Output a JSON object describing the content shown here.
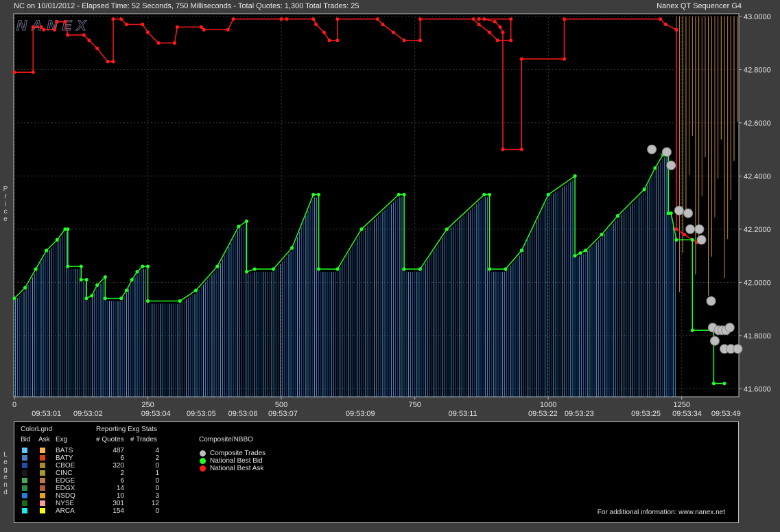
{
  "header": {
    "left": "NC on 10/01/2012  -  Elapsed Time: 52 Seconds, 750 Milliseconds  -  Total Quotes: 1,300  Total Trades: 25",
    "right": "Nanex QT Sequencer G4"
  },
  "watermark": "NANEX",
  "y_axis_title": "Price",
  "legend_side_label": "Legend",
  "chart_data": {
    "type": "line",
    "ylim": [
      41.57,
      43.01
    ],
    "xlim": [
      0,
      1300
    ],
    "y_ticks": [
      "43.0000",
      "42.8000",
      "42.6000",
      "42.4000",
      "42.2000",
      "42.0000",
      "41.8000",
      "41.6000"
    ],
    "y_tick_values": [
      43.0,
      42.8,
      42.6,
      42.4,
      42.2,
      42.0,
      41.8,
      41.6
    ],
    "x_ticks": [
      {
        "v": 0,
        "label": "0"
      },
      {
        "v": 250,
        "label": "250"
      },
      {
        "v": 500,
        "label": "500"
      },
      {
        "v": 750,
        "label": "750"
      },
      {
        "v": 1000,
        "label": "1000"
      },
      {
        "v": 1250,
        "label": "1250"
      }
    ],
    "time_labels": [
      {
        "v": 60,
        "label": "09:53:01"
      },
      {
        "v": 138,
        "label": "09:53:02"
      },
      {
        "v": 265,
        "label": "09:53:04"
      },
      {
        "v": 350,
        "label": "09:53:05"
      },
      {
        "v": 428,
        "label": "09:53:06"
      },
      {
        "v": 503,
        "label": "09:53:07"
      },
      {
        "v": 648,
        "label": "09:53:09"
      },
      {
        "v": 840,
        "label": "09:53:11"
      },
      {
        "v": 990,
        "label": "09:53:22"
      },
      {
        "v": 1058,
        "label": "09:53:23"
      },
      {
        "v": 1183,
        "label": "09:53:25"
      },
      {
        "v": 1260,
        "label": "09:53:34"
      },
      {
        "v": 1333,
        "label": "09:53:49"
      }
    ],
    "series": [
      {
        "name": "National Best Ask",
        "color": "#ff1a1a",
        "points": [
          [
            0,
            42.79
          ],
          [
            35,
            42.79
          ],
          [
            35,
            42.96
          ],
          [
            50,
            42.96
          ],
          [
            55,
            42.95
          ],
          [
            75,
            42.95
          ],
          [
            80,
            42.98
          ],
          [
            95,
            42.98
          ],
          [
            100,
            42.93
          ],
          [
            130,
            42.93
          ],
          [
            140,
            42.91
          ],
          [
            155,
            42.88
          ],
          [
            175,
            42.83
          ],
          [
            185,
            42.83
          ],
          [
            185,
            42.99
          ],
          [
            200,
            42.99
          ],
          [
            210,
            42.97
          ],
          [
            240,
            42.97
          ],
          [
            250,
            42.94
          ],
          [
            270,
            42.9
          ],
          [
            300,
            42.9
          ],
          [
            305,
            42.96
          ],
          [
            350,
            42.96
          ],
          [
            355,
            42.95
          ],
          [
            400,
            42.95
          ],
          [
            410,
            42.99
          ],
          [
            500,
            42.99
          ],
          [
            510,
            42.99
          ],
          [
            560,
            42.99
          ],
          [
            565,
            42.97
          ],
          [
            580,
            42.94
          ],
          [
            590,
            42.91
          ],
          [
            605,
            42.91
          ],
          [
            605,
            42.99
          ],
          [
            680,
            42.99
          ],
          [
            690,
            42.97
          ],
          [
            710,
            42.94
          ],
          [
            730,
            42.91
          ],
          [
            760,
            42.91
          ],
          [
            760,
            42.99
          ],
          [
            860,
            42.99
          ],
          [
            870,
            42.97
          ],
          [
            890,
            42.94
          ],
          [
            905,
            42.91
          ],
          [
            930,
            42.91
          ],
          [
            930,
            42.99
          ],
          [
            870,
            42.99
          ],
          [
            870,
            42.99
          ],
          [
            880,
            42.99
          ],
          [
            900,
            42.98
          ],
          [
            910,
            42.96
          ],
          [
            915,
            42.94
          ],
          [
            915,
            42.5
          ],
          [
            950,
            42.5
          ],
          [
            950,
            42.84
          ],
          [
            1030,
            42.84
          ],
          [
            1030,
            42.99
          ],
          [
            1210,
            42.99
          ],
          [
            1220,
            42.97
          ],
          [
            1240,
            42.95
          ],
          [
            1240,
            42.2
          ],
          [
            1255,
            42.18
          ],
          [
            1270,
            42.16
          ],
          [
            1280,
            42.15
          ],
          [
            1290,
            42.15
          ]
        ]
      },
      {
        "name": "National Best Bid",
        "color": "#22ff22",
        "points": [
          [
            0,
            41.94
          ],
          [
            20,
            41.98
          ],
          [
            40,
            42.05
          ],
          [
            60,
            42.12
          ],
          [
            80,
            42.16
          ],
          [
            95,
            42.2
          ],
          [
            100,
            42.2
          ],
          [
            100,
            42.06
          ],
          [
            125,
            42.06
          ],
          [
            125,
            42.01
          ],
          [
            135,
            42.01
          ],
          [
            135,
            41.94
          ],
          [
            145,
            41.95
          ],
          [
            155,
            41.99
          ],
          [
            170,
            42.02
          ],
          [
            170,
            41.94
          ],
          [
            200,
            41.94
          ],
          [
            210,
            41.97
          ],
          [
            220,
            42.01
          ],
          [
            230,
            42.04
          ],
          [
            240,
            42.06
          ],
          [
            250,
            42.06
          ],
          [
            250,
            41.93
          ],
          [
            310,
            41.93
          ],
          [
            340,
            41.97
          ],
          [
            380,
            42.06
          ],
          [
            420,
            42.21
          ],
          [
            435,
            42.23
          ],
          [
            435,
            42.04
          ],
          [
            450,
            42.05
          ],
          [
            485,
            42.05
          ],
          [
            520,
            42.13
          ],
          [
            560,
            42.33
          ],
          [
            570,
            42.33
          ],
          [
            570,
            42.05
          ],
          [
            605,
            42.05
          ],
          [
            650,
            42.2
          ],
          [
            720,
            42.33
          ],
          [
            730,
            42.33
          ],
          [
            730,
            42.05
          ],
          [
            760,
            42.05
          ],
          [
            810,
            42.2
          ],
          [
            880,
            42.33
          ],
          [
            890,
            42.33
          ],
          [
            890,
            42.05
          ],
          [
            920,
            42.05
          ],
          [
            950,
            42.12
          ],
          [
            1000,
            42.33
          ],
          [
            1050,
            42.4
          ],
          [
            1050,
            42.1
          ],
          [
            1060,
            42.11
          ],
          [
            1070,
            42.12
          ],
          [
            1100,
            42.18
          ],
          [
            1130,
            42.25
          ],
          [
            1180,
            42.35
          ],
          [
            1200,
            42.43
          ],
          [
            1215,
            42.48
          ],
          [
            1225,
            42.48
          ],
          [
            1225,
            42.26
          ],
          [
            1230,
            42.26
          ],
          [
            1240,
            42.16
          ],
          [
            1270,
            42.16
          ],
          [
            1270,
            41.82
          ],
          [
            1310,
            41.82
          ],
          [
            1310,
            41.62
          ],
          [
            1330,
            41.62
          ]
        ]
      },
      {
        "name": "Composite Trades",
        "color": "#bdbdbd",
        "points": [
          [
            1194,
            42.5
          ],
          [
            1222,
            42.49
          ],
          [
            1230,
            42.44
          ],
          [
            1245,
            42.27
          ],
          [
            1262,
            42.26
          ],
          [
            1266,
            42.2
          ],
          [
            1283,
            42.2
          ],
          [
            1287,
            42.16
          ],
          [
            1305,
            41.93
          ],
          [
            1308,
            41.83
          ],
          [
            1312,
            41.78
          ],
          [
            1319,
            41.82
          ],
          [
            1326,
            41.82
          ],
          [
            1333,
            41.82
          ],
          [
            1340,
            41.83
          ],
          [
            1330,
            41.75
          ],
          [
            1342,
            41.75
          ],
          [
            1355,
            41.75
          ]
        ]
      }
    ],
    "legend_headers": {
      "colorlgnd": "ColorLgnd",
      "reporting": "Reporting Exg Stats",
      "bid": "Bid",
      "ask": "Ask",
      "exg": "Exg",
      "quotes": "# Quotes",
      "trades": "# Trades",
      "composite": "Composite/NBBO"
    },
    "exchanges": [
      {
        "exg": "BATS",
        "bid_color": "#5fc8ff",
        "ask_color": "#ffb347",
        "quotes": "487",
        "trades": "4"
      },
      {
        "exg": "BATY",
        "bid_color": "#4a7fc1",
        "ask_color": "#e04010",
        "quotes": "6",
        "trades": "2"
      },
      {
        "exg": "CBOE",
        "bid_color": "#1f4fa8",
        "ask_color": "#b08820",
        "quotes": "320",
        "trades": "0"
      },
      {
        "exg": "CINC",
        "bid_color": "#1a1a1a",
        "ask_color": "#a89a2a",
        "quotes": "2",
        "trades": "1"
      },
      {
        "exg": "EDGE",
        "bid_color": "#4aa85a",
        "ask_color": "#c07848",
        "quotes": "6",
        "trades": "0"
      },
      {
        "exg": "EDGX",
        "bid_color": "#2a8a4a",
        "ask_color": "#b05a40",
        "quotes": "14",
        "trades": "0"
      },
      {
        "exg": "NSDQ",
        "bid_color": "#2a7ad8",
        "ask_color": "#e8a020",
        "quotes": "10",
        "trades": "3"
      },
      {
        "exg": "NYSE",
        "bid_color": "#1a6a1a",
        "ask_color": "#ff9a9a",
        "quotes": "301",
        "trades": "12"
      },
      {
        "exg": "ARCA",
        "bid_color": "#22e8e8",
        "ask_color": "#ffff00",
        "quotes": "154",
        "trades": "0"
      }
    ],
    "nbbo_legend": [
      {
        "label": "Composite Trades",
        "color": "#bdbdbd"
      },
      {
        "label": "National Best Bid",
        "color": "#22ff22"
      },
      {
        "label": "National Best Ask",
        "color": "#ff1a1a"
      }
    ],
    "footer_note": "For additional information: www.nanex.net"
  }
}
